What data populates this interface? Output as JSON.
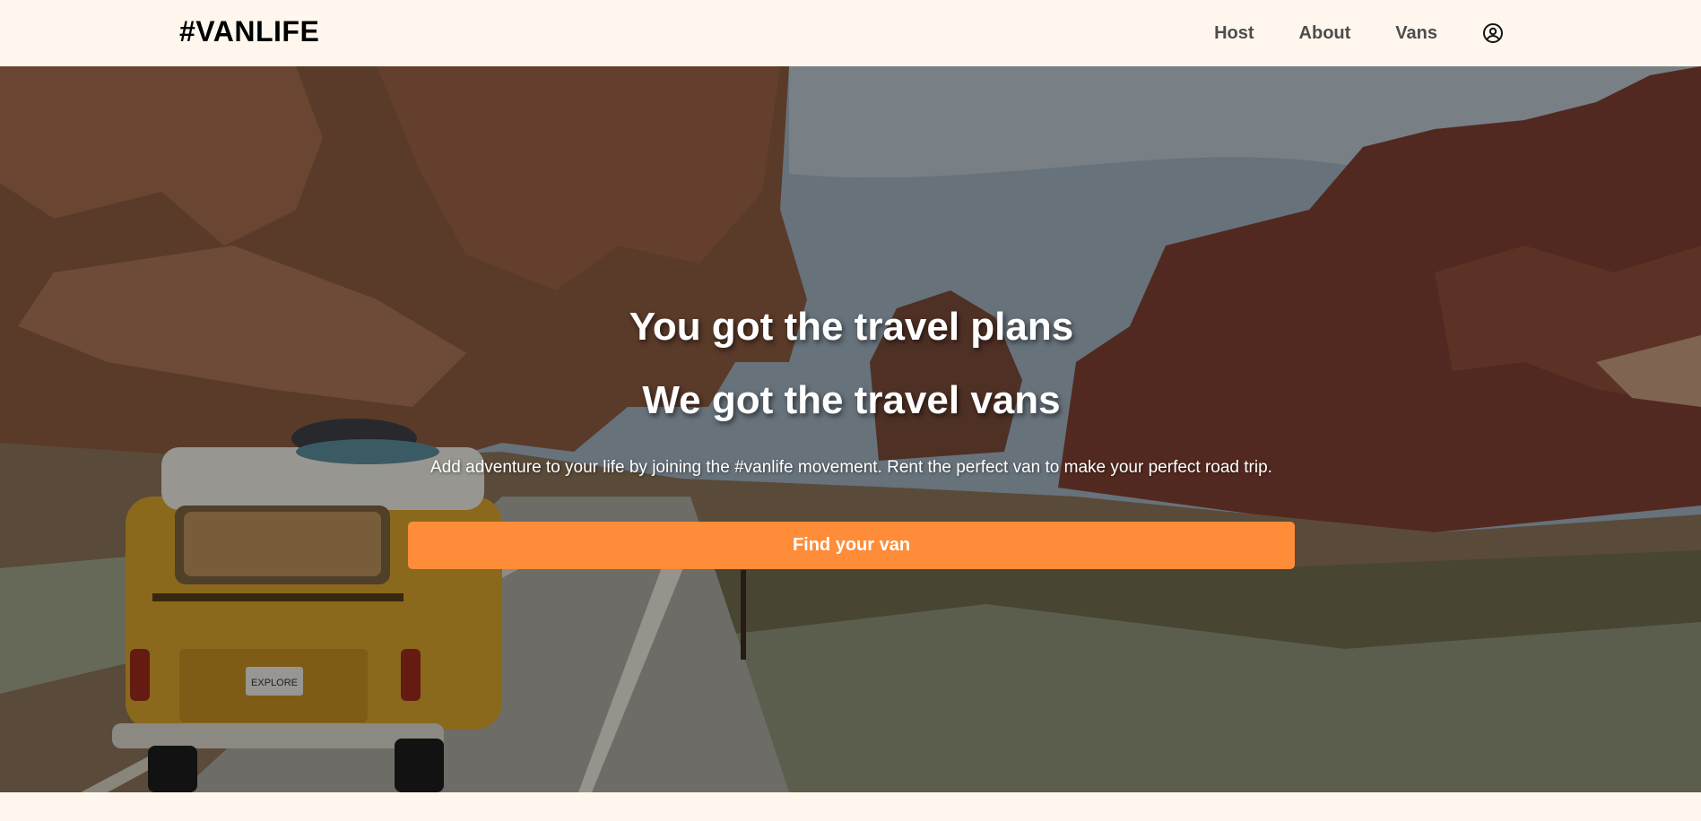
{
  "header": {
    "logo": "#VANLIFE",
    "nav": [
      {
        "label": "Host"
      },
      {
        "label": "About"
      },
      {
        "label": "Vans"
      }
    ],
    "user_icon": "user-circle-icon"
  },
  "hero": {
    "title_line1": "You got the travel plans",
    "title_line2": "We got the travel vans",
    "description": "Add adventure to your life by joining the #vanlife movement. Rent the perfect van to make your perfect road trip.",
    "cta_label": "Find your van",
    "van_plate": "EXPLORE"
  },
  "colors": {
    "background": "#FFF7ED",
    "accent": "#FF8C38",
    "nav_text": "#4D4D4D"
  }
}
